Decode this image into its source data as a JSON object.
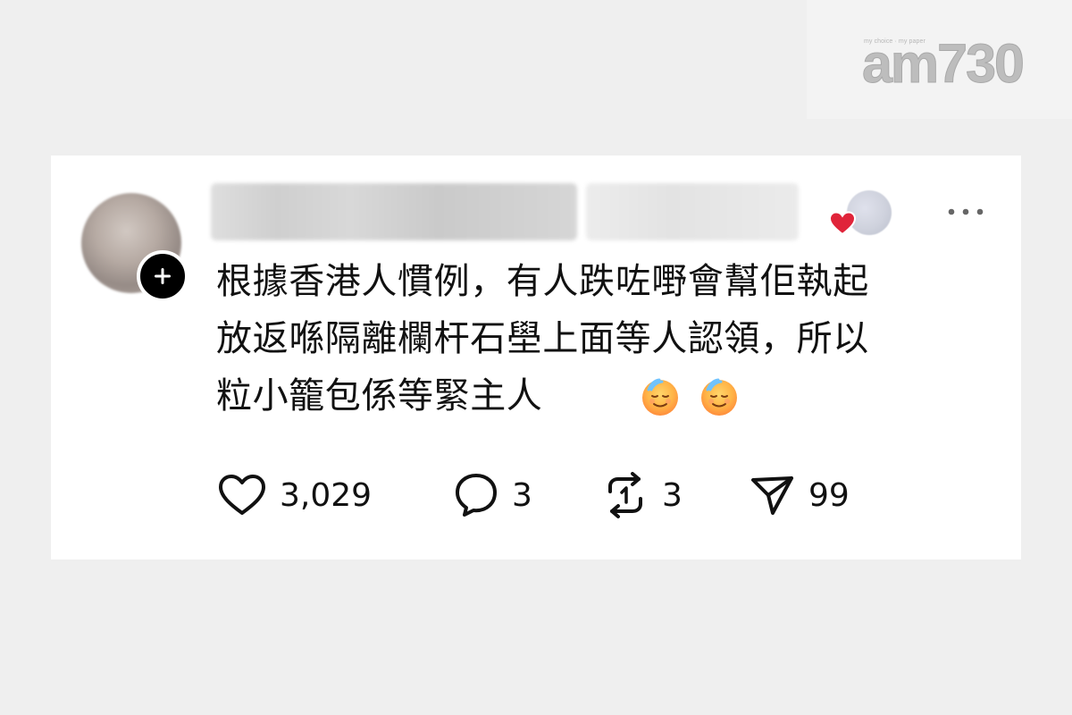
{
  "brand": {
    "tagline": "my choice · my paper",
    "wordmark": "am730"
  },
  "post": {
    "text": "根據香港人慣例，有人跌咗嘢會幫佢執起\n放返喺隔離欄杆石壆上面等人認領，所以\n粒小籠包係等緊主人",
    "emoji": [
      "sweat-smile-emoji",
      "sweat-smile-emoji"
    ]
  },
  "stats": {
    "likes": "3,029",
    "comments": "3",
    "reposts": "3",
    "shares": "99"
  },
  "icons": {
    "follow": "plus-icon",
    "reaction": "heart-icon",
    "more": "more-dots-icon",
    "like": "heart-outline-icon",
    "comment": "comment-bubble-icon",
    "repost": "repost-icon",
    "share": "send-icon"
  },
  "colors": {
    "background": "#efefef",
    "card": "#ffffff",
    "text": "#111111",
    "heart": "#e0243a"
  }
}
